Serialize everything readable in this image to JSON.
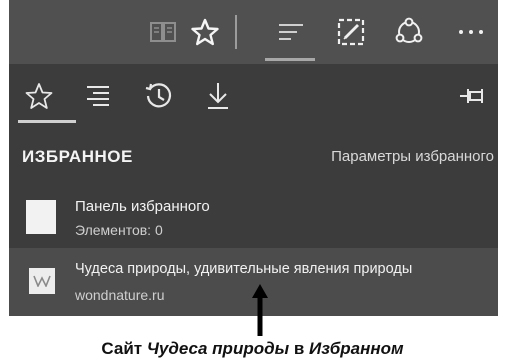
{
  "toolbar": {
    "icons": [
      "reading-view-icon",
      "favorites-star-icon",
      "hub-icon",
      "web-note-icon",
      "share-icon",
      "more-icon"
    ]
  },
  "hub": {
    "tabs": [
      "favorites-tab",
      "reading-list-tab",
      "history-tab",
      "downloads-tab"
    ],
    "pin_icon": "pin-icon",
    "title": "ИЗБРАННОЕ",
    "settings_link": "Параметры избранного",
    "items": [
      {
        "title": "Панель избранного",
        "subtitle": "Элементов: 0",
        "icon": "folder-icon"
      },
      {
        "title": "Чудеса природы, удивительные явления природы",
        "subtitle": "wondnature.ru",
        "icon": "site-favicon-icon"
      }
    ]
  },
  "caption": {
    "part1": "Сайт ",
    "part2": "Чудеса природы",
    "part3": " в ",
    "part4": "Избранном"
  },
  "colors": {
    "toolbar_bg": "#505050",
    "panel_bg": "#3c3c3c",
    "highlight_row": "#4c4c4c"
  }
}
